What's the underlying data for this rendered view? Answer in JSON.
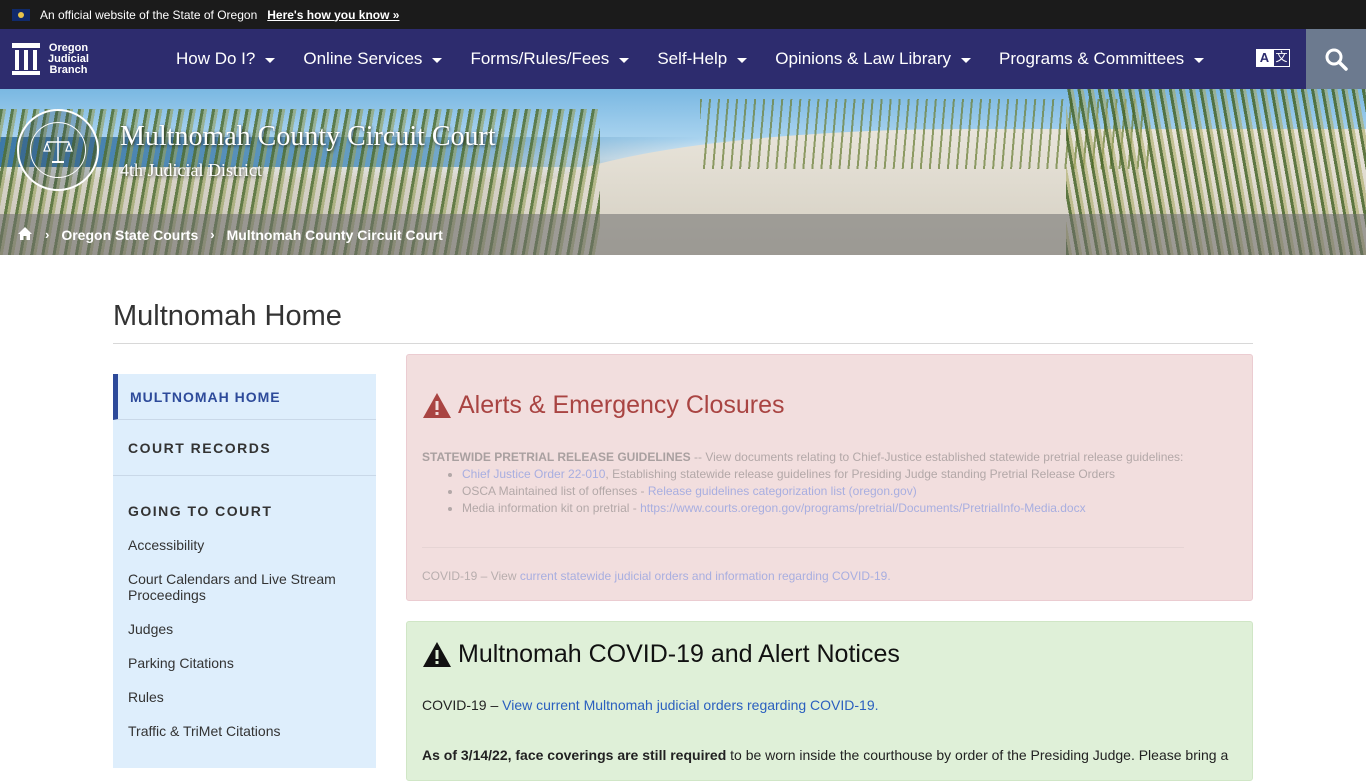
{
  "banner": {
    "official_text": "An official website of the State of Oregon",
    "how_link": "Here's how you know »"
  },
  "nav": {
    "logo_line1": "Oregon",
    "logo_line2": "Judicial",
    "logo_line3": "Branch",
    "items": [
      {
        "label": "How Do I?"
      },
      {
        "label": "Online Services"
      },
      {
        "label": "Forms/Rules/Fees"
      },
      {
        "label": "Self-Help"
      },
      {
        "label": "Opinions & Law Library"
      },
      {
        "label": "Programs & Committees"
      }
    ],
    "translate_a": "A",
    "translate_b": "文"
  },
  "hero": {
    "title": "Multnomah County Circuit Court",
    "subtitle": "4th Judicial District",
    "breadcrumb": [
      "Oregon State Courts",
      "Multnomah County Circuit Court"
    ]
  },
  "page": {
    "title": "Multnomah Home"
  },
  "sidebar": {
    "active": "MULTNOMAH HOME",
    "court_records": "COURT RECORDS",
    "going_to_court": "GOING TO COURT",
    "links": [
      "Accessibility",
      "Court Calendars and Live Stream Proceedings",
      "Judges",
      "Parking Citations",
      "Rules",
      "Traffic & TriMet Citations"
    ]
  },
  "alert": {
    "title": "Alerts & Emergency Closures",
    "pretrial_heading": "STATEWIDE PRETRIAL RELEASE GUIDELINES",
    "pretrial_text": " -- View documents relating to Chief-Justice established statewide pretrial release guidelines:",
    "item1_link": "Chief Justice Order 22-010",
    "item1_text": ", Establishing statewide release guidelines for Presiding Judge standing Pretrial Release Orders",
    "item2_text": "OSCA Maintained list of offenses - ",
    "item2_link": "Release guidelines categorization list (oregon.gov)",
    "item3_text": "Media information kit on pretrial - ",
    "item3_link": "https://www.courts.oregon.gov/programs/pretrial/Documents/PretrialInfo-Media.docx",
    "covid_text": "COVID-19 – View ",
    "covid_link": "current statewide judicial orders and information regarding COVID-19."
  },
  "notice": {
    "title": "Multnomah COVID-19 and Alert Notices",
    "covid_text": "COVID-19 – ",
    "covid_link": "View current Multnomah judicial orders regarding COVID-19.",
    "mask_bold": "As of 3/14/22, face coverings are still required",
    "mask_text": " to be worn inside the courthouse by order of the Presiding Judge.  Please bring a"
  },
  "colors": {
    "nav_bg": "#2d2c6e",
    "alert_bg": "#f2dede",
    "alert_title": "#a94442",
    "notice_bg": "#dff0d8",
    "sidebar_bg": "#deeefc",
    "link": "#2a5fbf"
  }
}
